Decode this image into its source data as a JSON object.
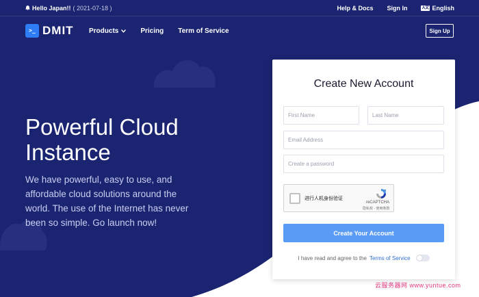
{
  "colors": {
    "hero_bg": "#1b2470",
    "accent": "#2e7cf6",
    "button": "#5a9cf5",
    "link": "#2e6fd1"
  },
  "topbar": {
    "announcement": "Hello Japan!!",
    "announcement_date": "( 2021-07-18 )",
    "links": [
      "Help & Docs",
      "Sign In"
    ],
    "language": "English"
  },
  "nav": {
    "logo_text": "DMIT",
    "items": [
      "Products",
      "Pricing",
      "Term of Service"
    ],
    "signup_label": "Sign Up"
  },
  "hero": {
    "headline": "Powerful Cloud Instance",
    "subtext": "We have powerful, easy to use, and affordable cloud solutions around the world. The use of the Internet has never been so simple. Go launch now!"
  },
  "form": {
    "title": "Create New Account",
    "first_name_placeholder": "First Name",
    "last_name_placeholder": "Last Name",
    "email_placeholder": "Email Address",
    "password_placeholder": "Create a password",
    "captcha_label": "进行人机身份验证",
    "captcha_brand": "reCAPTCHA",
    "captcha_terms": "隐私权 - 使用条款",
    "submit_label": "Create Your Account",
    "agree_text": "I have read and agree to the",
    "agree_link": "Terms of Service"
  },
  "watermark": "云服务器网 www.yuntue.com"
}
